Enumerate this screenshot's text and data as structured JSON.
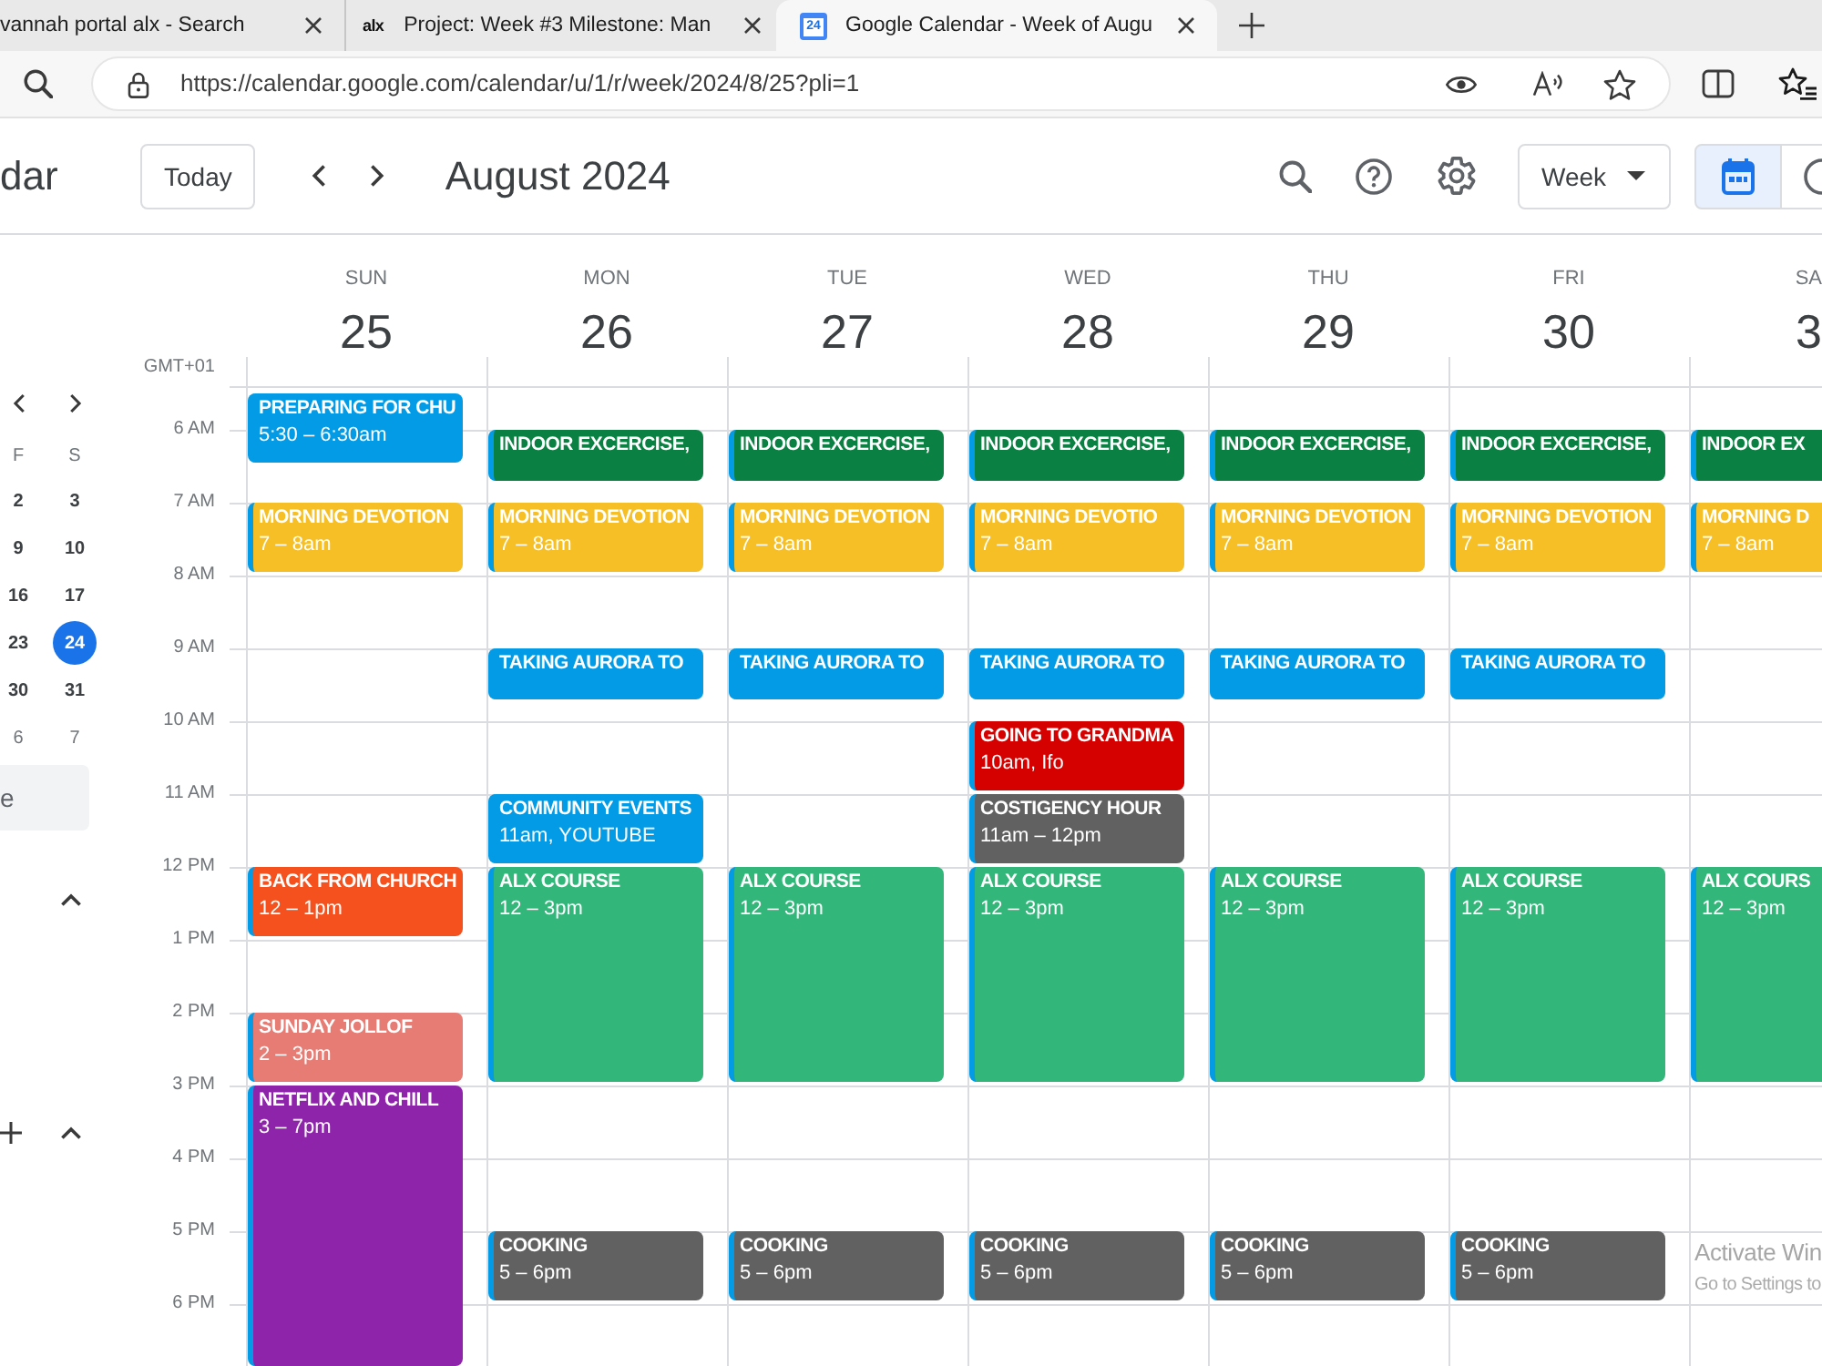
{
  "browser": {
    "tabs": [
      {
        "title": "vannah portal alx - Search",
        "selected": false
      },
      {
        "title": "Project: Week #3 Milestone: Man",
        "favicon": {
          "kind": "wordmark",
          "text": "alx"
        },
        "selected": false
      },
      {
        "title": "Google Calendar - Week of Augu",
        "favicon": {
          "kind": "calendar",
          "text": "24"
        },
        "selected": true
      }
    ],
    "url": "https://calendar.google.com/calendar/u/1/r/week/2024/8/25?pli=1"
  },
  "header": {
    "app_title": "dar",
    "today_button": "Today",
    "period": "August 2024",
    "view_select": "Week",
    "view_toggles": [
      {
        "selected": true
      },
      {
        "selected": false
      }
    ]
  },
  "mini_calendar": {
    "weekdays": [
      "F",
      "S"
    ],
    "weeks": [
      [
        {
          "day": "2",
          "today": false,
          "outside_month": false
        },
        {
          "day": "3",
          "today": false,
          "outside_month": false
        }
      ],
      [
        {
          "day": "9",
          "today": false,
          "outside_month": false
        },
        {
          "day": "10",
          "today": false,
          "outside_month": false
        }
      ],
      [
        {
          "day": "16",
          "today": false,
          "outside_month": false
        },
        {
          "day": "17",
          "today": false,
          "outside_month": false
        }
      ],
      [
        {
          "day": "23",
          "today": false,
          "outside_month": false
        },
        {
          "day": "24",
          "today": true,
          "outside_month": false
        }
      ],
      [
        {
          "day": "30",
          "today": false,
          "outside_month": false
        },
        {
          "day": "31",
          "today": false,
          "outside_month": false
        }
      ],
      [
        {
          "day": "6",
          "today": false,
          "outside_month": true
        },
        {
          "day": "7",
          "today": false,
          "outside_month": true
        }
      ]
    ]
  },
  "people_search": {
    "placeholder": "e"
  },
  "sidebar_sections": [
    {
      "expanded": true,
      "add_button": false
    },
    {
      "expanded": true,
      "add_button": true
    }
  ],
  "week": {
    "timezone": "GMT+01",
    "hours": [
      "6 AM",
      "7 AM",
      "8 AM",
      "9 AM",
      "10 AM",
      "11 AM",
      "12 PM",
      "1 PM",
      "2 PM",
      "3 PM",
      "4 PM",
      "5 PM",
      "6 PM"
    ],
    "days": [
      {
        "weekday": "SUN",
        "date": "25",
        "events": [
          {
            "title": "PREPARING FOR CHU",
            "time": "5:30 – 6:30am",
            "color": "#039be5"
          },
          {
            "title": "MORNING DEVOTION",
            "time": "7 – 8am",
            "color": "#f6bf26"
          },
          {
            "title": "BACK FROM CHURCH",
            "time": "12 – 1pm",
            "color": "#f4511e"
          },
          {
            "title": "SUNDAY JOLLOF",
            "time": "2 – 3pm",
            "color": "#e67c73"
          },
          {
            "title": "NETFLIX AND CHILL",
            "time": "3 – 7pm",
            "color": "#8e24aa"
          }
        ]
      },
      {
        "weekday": "MON",
        "date": "26",
        "events": [
          {
            "title": "INDOOR EXCERCISE,",
            "color": "#0b8043"
          },
          {
            "title": "MORNING DEVOTION",
            "time": "7 – 8am",
            "color": "#f6bf26"
          },
          {
            "title": "TAKING AURORA TO",
            "color": "#039be5"
          },
          {
            "title": "COMMUNITY EVENTS",
            "time": "11am, YOUTUBE",
            "color": "#039be5"
          },
          {
            "title": "ALX COURSE",
            "time": "12 – 3pm",
            "color": "#33b679"
          },
          {
            "title": "COOKING",
            "time": "5 – 6pm",
            "color": "#616161"
          }
        ]
      },
      {
        "weekday": "TUE",
        "date": "27",
        "events": [
          {
            "title": "INDOOR EXCERCISE,",
            "color": "#0b8043"
          },
          {
            "title": "MORNING DEVOTION",
            "time": "7 – 8am",
            "color": "#f6bf26"
          },
          {
            "title": "TAKING AURORA TO",
            "color": "#039be5"
          },
          {
            "title": "ALX COURSE",
            "time": "12 – 3pm",
            "color": "#33b679"
          },
          {
            "title": "COOKING",
            "time": "5 – 6pm",
            "color": "#616161"
          }
        ]
      },
      {
        "weekday": "WED",
        "date": "28",
        "events": [
          {
            "title": "INDOOR EXCERCISE,",
            "color": "#0b8043"
          },
          {
            "title": "MORNING DEVOTIO",
            "time": "7 – 8am",
            "color": "#f6bf26"
          },
          {
            "title": "TAKING AURORA TO",
            "color": "#039be5"
          },
          {
            "title": "GOING TO GRANDMA",
            "time": "10am, Ifo",
            "color": "#d50000"
          },
          {
            "title": "COSTIGENCY HOUR",
            "time": "11am – 12pm",
            "color": "#616161"
          },
          {
            "title": "ALX COURSE",
            "time": "12 – 3pm",
            "color": "#33b679"
          },
          {
            "title": "COOKING",
            "time": "5 – 6pm",
            "color": "#616161"
          }
        ]
      },
      {
        "weekday": "THU",
        "date": "29",
        "events": [
          {
            "title": "INDOOR EXCERCISE,",
            "color": "#0b8043"
          },
          {
            "title": "MORNING DEVOTION",
            "time": "7 – 8am",
            "color": "#f6bf26"
          },
          {
            "title": "TAKING AURORA TO",
            "color": "#039be5"
          },
          {
            "title": "ALX COURSE",
            "time": "12 – 3pm",
            "color": "#33b679"
          },
          {
            "title": "COOKING",
            "time": "5 – 6pm",
            "color": "#616161"
          }
        ]
      },
      {
        "weekday": "FRI",
        "date": "30",
        "events": [
          {
            "title": "INDOOR EXCERCISE,",
            "color": "#0b8043"
          },
          {
            "title": "MORNING DEVOTION",
            "time": "7 – 8am",
            "color": "#f6bf26"
          },
          {
            "title": "TAKING AURORA TO",
            "color": "#039be5"
          },
          {
            "title": "ALX COURSE",
            "time": "12 – 3pm",
            "color": "#33b679"
          },
          {
            "title": "COOKING",
            "time": "5 – 6pm",
            "color": "#616161"
          }
        ]
      },
      {
        "weekday": "SA",
        "date": "3",
        "events": [
          {
            "title": "INDOOR EX",
            "color": "#0b8043"
          },
          {
            "title": "MORNING D",
            "time": "7 – 8am",
            "color": "#f6bf26"
          },
          {
            "title": "ALX COURS",
            "time": "12 – 3pm",
            "color": "#33b679"
          }
        ]
      }
    ]
  },
  "os_notice": {
    "title": "Activate Win",
    "subtitle": "Go to Settings to"
  }
}
